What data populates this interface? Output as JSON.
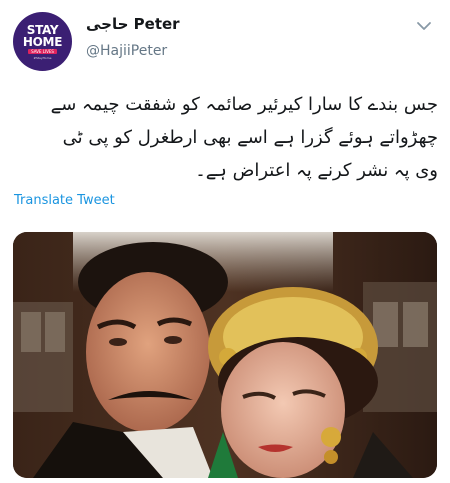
{
  "tweet": {
    "avatar": {
      "line1": "STAY",
      "line2": "HOME",
      "line3": "SAVE LIVES",
      "line4": "#StayHome"
    },
    "display_name": "حاجی Peter",
    "handle": "@HajiiPeter",
    "text_lines": [
      "جس بندے کا سارا کیرئیر صائمہ کو شفقت چیمہ سے",
      "چھڑواتے ہوئے گزرا ہے اسے بھی ارطغرل کو پی ٹی",
      "وی پہ نشر کرنے پہ اعتراض ہے۔"
    ],
    "translate_label": "Translate Tweet",
    "menu_icon": "chevron-down-icon",
    "media_icon": "photo"
  },
  "colors": {
    "link": "#1b95e0",
    "handle": "#657786",
    "avatar_bg": "#3b1f73"
  }
}
